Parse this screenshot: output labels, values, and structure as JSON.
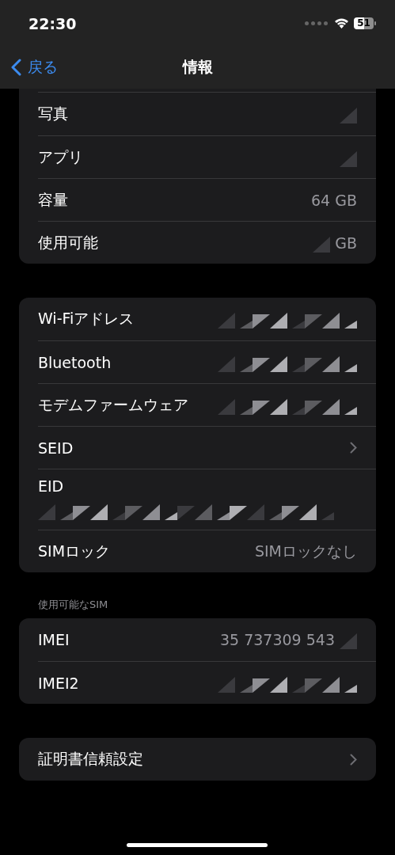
{
  "status_bar": {
    "time": "22:30",
    "battery": "51"
  },
  "nav": {
    "back": "戻る",
    "title": "情報"
  },
  "groups": [
    {
      "rows": [
        {
          "kind": "value",
          "label": "写真",
          "redacted": true
        },
        {
          "kind": "value",
          "label": "アプリ",
          "redacted": true
        },
        {
          "kind": "value",
          "label": "容量",
          "value": "64 GB"
        },
        {
          "kind": "value",
          "label": "使用可能",
          "value": "GB",
          "redacted": true
        }
      ],
      "cut_top": true
    },
    {
      "rows": [
        {
          "kind": "value",
          "label": "Wi-Fiアドレス",
          "redacted": true
        },
        {
          "kind": "value",
          "label": "Bluetooth",
          "redacted": true
        },
        {
          "kind": "value",
          "label": "モデムファームウェア",
          "redacted": true
        },
        {
          "kind": "chevron",
          "label": "SEID"
        },
        {
          "kind": "stacked",
          "label": "EID",
          "redacted": true
        },
        {
          "kind": "value",
          "label": "SIMロック",
          "value": "SIMロックなし"
        }
      ]
    },
    {
      "header": "使用可能なSIM",
      "rows": [
        {
          "kind": "value",
          "label": "IMEI",
          "value": "35 737309 543",
          "redacted": true,
          "redaction_after": true
        },
        {
          "kind": "value",
          "label": "IMEI2",
          "redacted": true
        }
      ]
    },
    {
      "rows": [
        {
          "kind": "chevron",
          "label": "証明書信頼設定"
        }
      ]
    }
  ]
}
